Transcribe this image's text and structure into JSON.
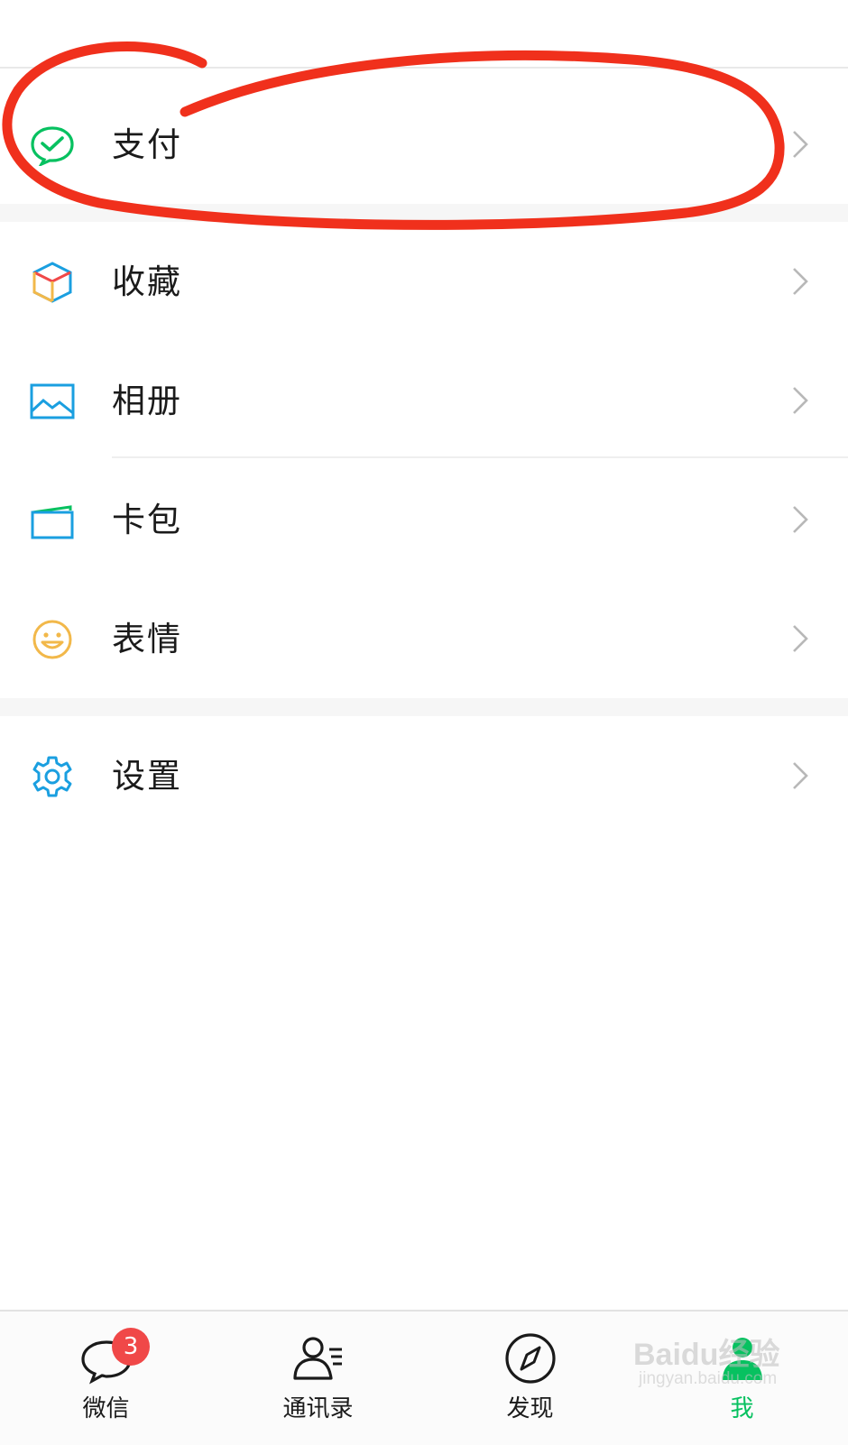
{
  "menu": {
    "items": [
      {
        "label": "支付",
        "icon": "wechat-pay-icon"
      },
      {
        "label": "收藏",
        "icon": "favorites-cube-icon"
      },
      {
        "label": "相册",
        "icon": "album-picture-icon"
      },
      {
        "label": "卡包",
        "icon": "card-wallet-icon"
      },
      {
        "label": "表情",
        "icon": "smiley-face-icon"
      },
      {
        "label": "设置",
        "icon": "gear-icon"
      }
    ]
  },
  "annotation": {
    "color": "#f0301c",
    "shape": "hand-drawn circle around 支付"
  },
  "tabbar": {
    "tabs": [
      {
        "label": "微信",
        "icon": "chat-bubble-icon",
        "badge": "3",
        "active": false
      },
      {
        "label": "通讯录",
        "icon": "contacts-icon",
        "active": false
      },
      {
        "label": "发现",
        "icon": "compass-icon",
        "active": false
      },
      {
        "label": "我",
        "icon": "person-icon",
        "active": true
      }
    ]
  },
  "watermark": {
    "brand": "Baidu经验",
    "url": "jingyan.baidu.com"
  },
  "colors": {
    "accent_green": "#07c160",
    "badge_red": "#f04848",
    "annotation_red": "#f0301c",
    "icon_blue": "#1a9fe0",
    "icon_yellow": "#f2b84a"
  }
}
